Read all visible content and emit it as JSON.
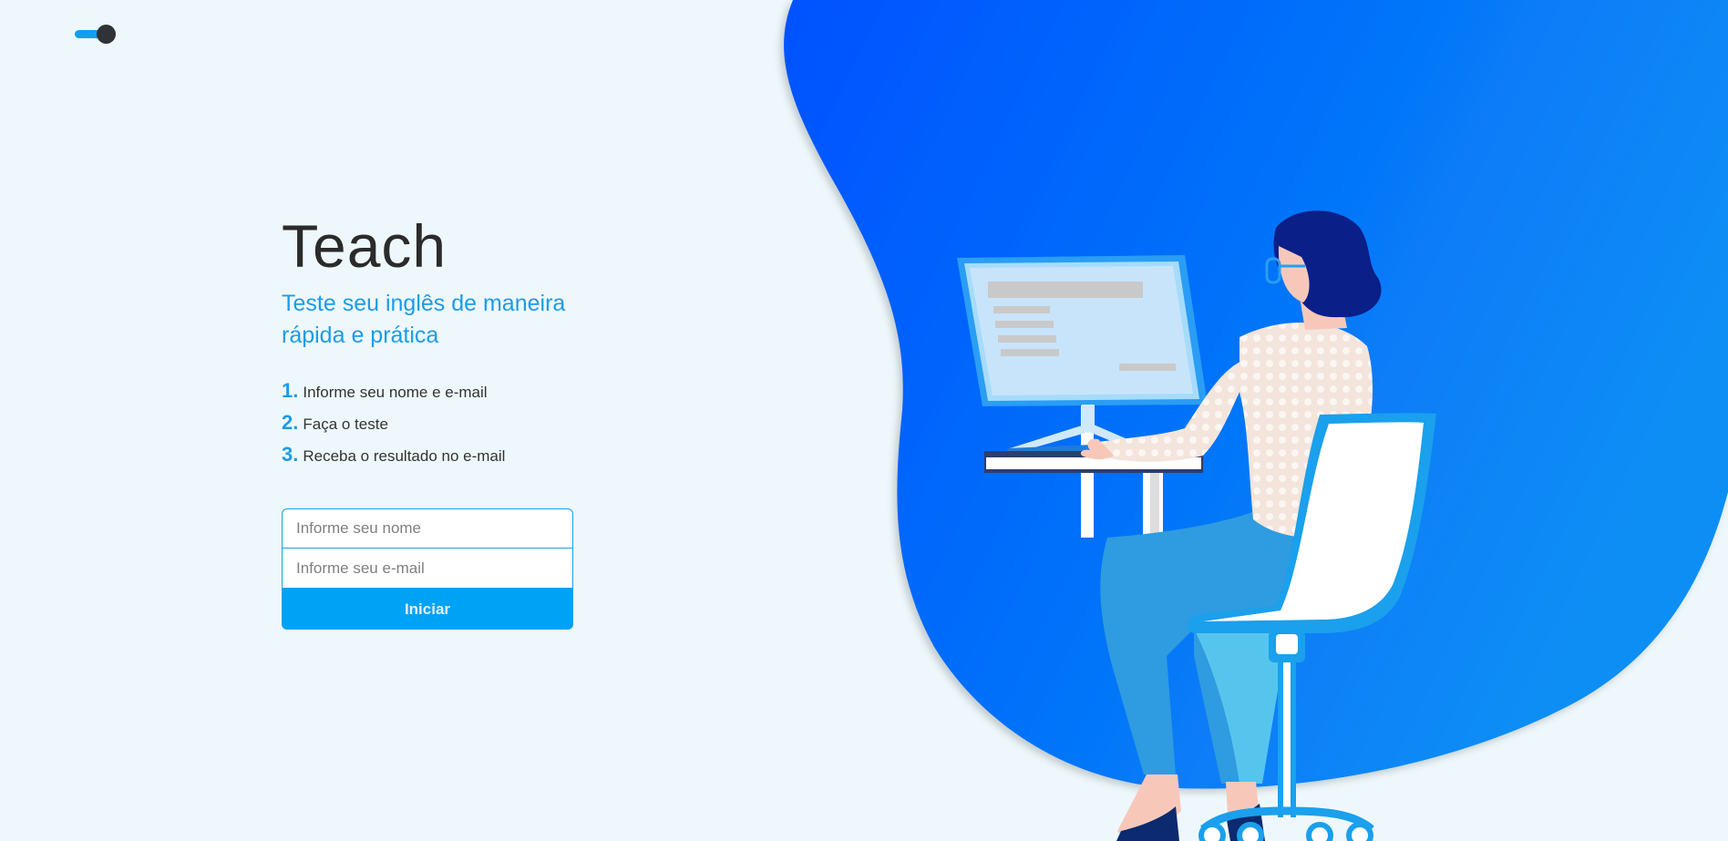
{
  "header": {
    "theme_toggle": {
      "state": "on",
      "accent": "#0ea0f0"
    }
  },
  "hero": {
    "title": "Teach",
    "subtitle": "Teste seu inglês de maneira rápida e prática",
    "steps": [
      {
        "number": "1.",
        "text": "Informe seu nome e e-mail"
      },
      {
        "number": "2.",
        "text": "Faça o teste"
      },
      {
        "number": "3.",
        "text": "Receba o resultado no e-mail"
      }
    ]
  },
  "form": {
    "name_placeholder": "Informe seu nome",
    "email_placeholder": "Informe seu e-mail",
    "name_value": "",
    "email_value": "",
    "submit_label": "Iniciar"
  },
  "colors": {
    "background": "#eef8fc",
    "accent": "#00a2f5",
    "blob_start": "#0052ff",
    "blob_end": "#0a8ef5"
  },
  "illustration": {
    "icon": "woman-at-computer-illustration"
  }
}
